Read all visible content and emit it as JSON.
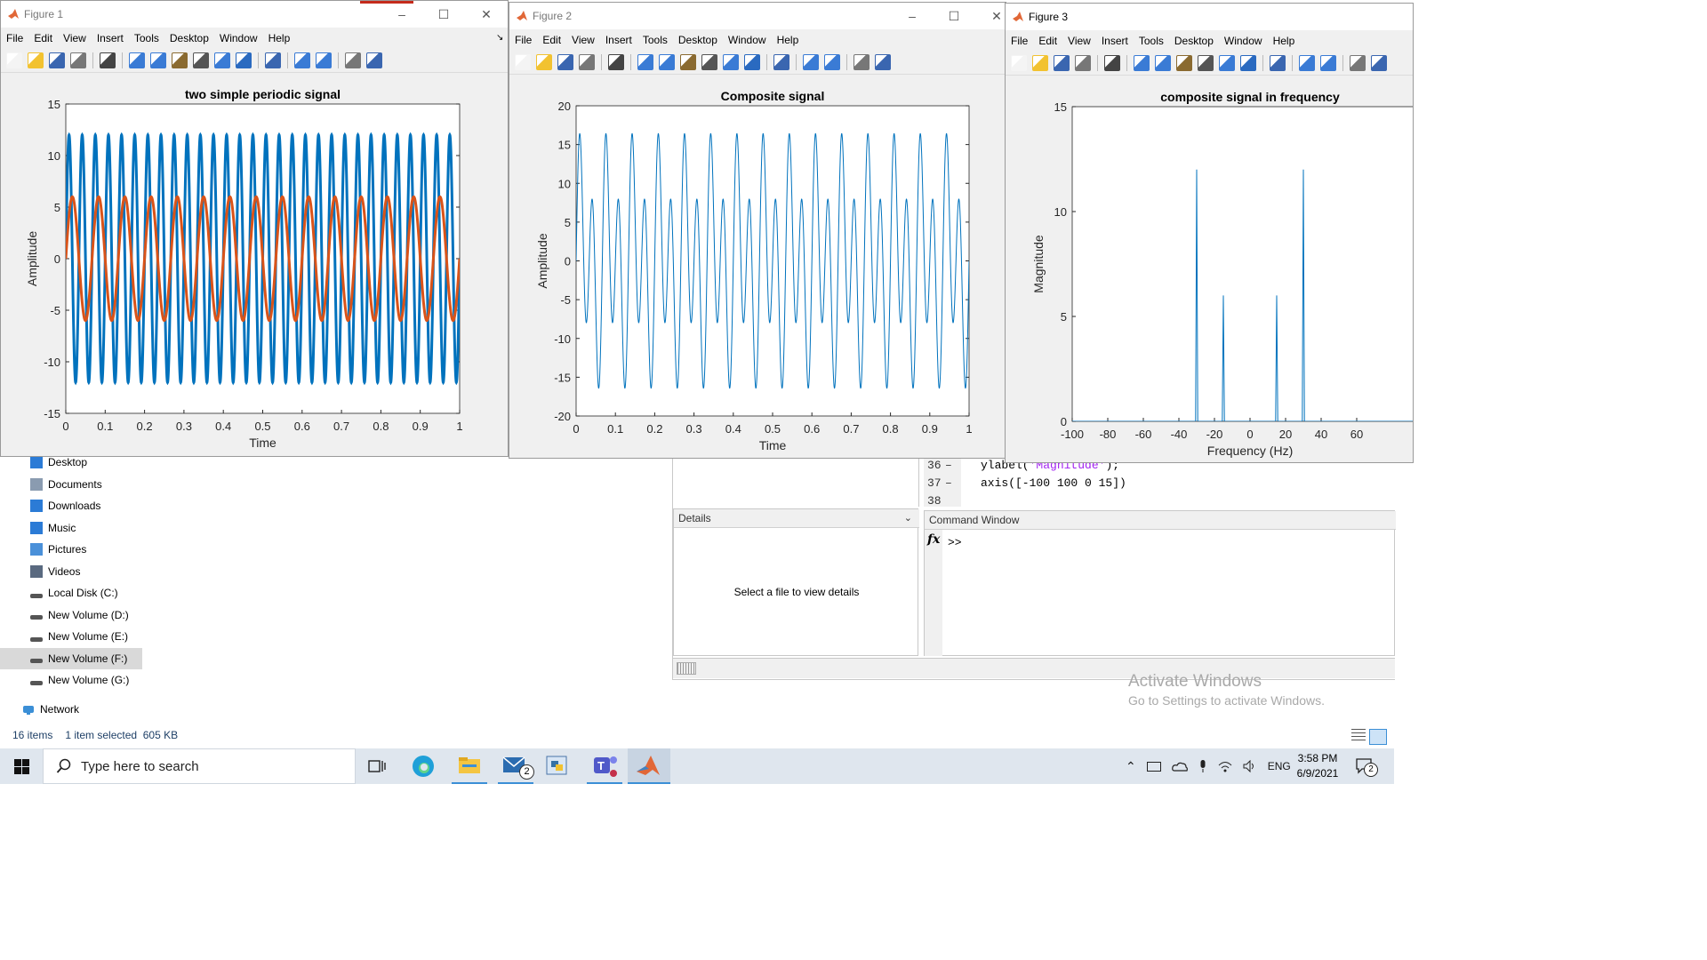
{
  "explorer": {
    "nav_items": [
      {
        "label": "Desktop",
        "icon": "desktop-icon"
      },
      {
        "label": "Documents",
        "icon": "documents-icon"
      },
      {
        "label": "Downloads",
        "icon": "downloads-icon"
      },
      {
        "label": "Music",
        "icon": "music-icon"
      },
      {
        "label": "Pictures",
        "icon": "pictures-icon"
      },
      {
        "label": "Videos",
        "icon": "videos-icon"
      },
      {
        "label": "Local Disk (C:)",
        "icon": "drive-icon"
      },
      {
        "label": "New Volume (D:)",
        "icon": "drive-icon"
      },
      {
        "label": "New Volume (E:)",
        "icon": "drive-icon"
      },
      {
        "label": "New Volume (F:)",
        "icon": "drive-icon",
        "selected": true
      },
      {
        "label": "New Volume (G:)",
        "icon": "drive-icon"
      }
    ],
    "network_label": "Network",
    "status": {
      "items": "16 items",
      "selected": "1 item selected",
      "size": "605 KB"
    }
  },
  "matlab": {
    "details_title": "Details",
    "details_placeholder": "Select a file to view details",
    "code_lines": [
      {
        "num": "36",
        "dash": "–",
        "pre": "ylabel(",
        "str": "'Magnitude'",
        "post": ");"
      },
      {
        "num": "37",
        "dash": "–",
        "pre": "axis([-100 100 0 15])",
        "str": "",
        "post": ""
      },
      {
        "num": "38",
        "dash": "",
        "pre": "",
        "str": "",
        "post": ""
      }
    ],
    "command_window_title": "Command Window",
    "fx_label": "fx",
    "prompt": ">>"
  },
  "watermark": {
    "title": "Activate Windows",
    "subtitle": "Go to Settings to activate Windows."
  },
  "figure_menu": [
    "File",
    "Edit",
    "View",
    "Insert",
    "Tools",
    "Desktop",
    "Window",
    "Help"
  ],
  "figures": [
    {
      "window_title": "Figure 1"
    },
    {
      "window_title": "Figure 2"
    },
    {
      "window_title": "Figure 3"
    }
  ],
  "chart_data": [
    {
      "type": "line",
      "title": "two simple periodic signal",
      "xlabel": "Time",
      "ylabel": "Amplitude",
      "xlim": [
        0,
        1
      ],
      "ylim": [
        -15,
        15
      ],
      "xticks": [
        "0",
        "0.1",
        "0.2",
        "0.3",
        "0.4",
        "0.5",
        "0.6",
        "0.7",
        "0.8",
        "0.9",
        "1"
      ],
      "yticks": [
        "-15",
        "-10",
        "-5",
        "0",
        "5",
        "10",
        "15"
      ],
      "series": [
        {
          "amplitude": 12,
          "frequency_hz": 30,
          "color": "#0072bd"
        },
        {
          "amplitude": 6,
          "frequency_hz": 15,
          "color": "#d95319"
        }
      ]
    },
    {
      "type": "line",
      "title": "Composite signal",
      "xlabel": "Time",
      "ylabel": "Amplitude",
      "xlim": [
        0,
        1
      ],
      "ylim": [
        -20,
        20
      ],
      "xticks": [
        "0",
        "0.1",
        "0.2",
        "0.3",
        "0.4",
        "0.5",
        "0.6",
        "0.7",
        "0.8",
        "0.9",
        "1"
      ],
      "yticks": [
        "-20",
        "-15",
        "-10",
        "-5",
        "0",
        "5",
        "10",
        "15",
        "20"
      ],
      "series": [
        {
          "components": [
            {
              "amplitude": 12,
              "frequency_hz": 30
            },
            {
              "amplitude": 6,
              "frequency_hz": 15
            }
          ],
          "color": "#0072bd"
        }
      ]
    },
    {
      "type": "line",
      "title": "composite signal in frequency",
      "xlabel": "Frequency (Hz)",
      "ylabel": "Magnitude",
      "xlim": [
        -100,
        100
      ],
      "ylim": [
        0,
        15
      ],
      "xticks": [
        "-100",
        "-80",
        "-60",
        "-40",
        "-20",
        "0",
        "20",
        "40",
        "60"
      ],
      "yticks": [
        "0",
        "5",
        "10",
        "15"
      ],
      "series": [
        {
          "peaks": [
            {
              "x": -30,
              "y": 12
            },
            {
              "x": -15,
              "y": 6
            },
            {
              "x": 15,
              "y": 6
            },
            {
              "x": 30,
              "y": 12
            }
          ],
          "color": "#0072bd"
        }
      ]
    }
  ],
  "taskbar": {
    "search_placeholder": "Type here to search",
    "mail_badge": "2",
    "language": "ENG",
    "time": "3:58 PM",
    "date": "6/9/2021",
    "notification_count": "2"
  }
}
